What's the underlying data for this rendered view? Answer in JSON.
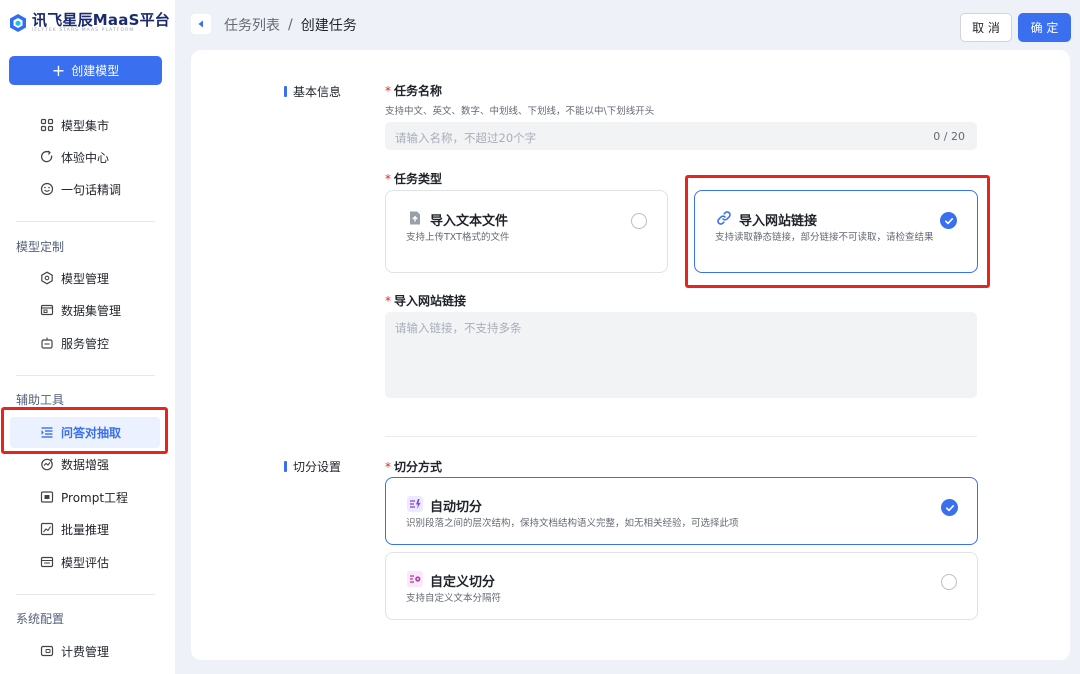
{
  "brand": {
    "name": "讯飞星辰MaaS平台",
    "subtitle": "IFLYTEK STARS MAAS PLATFORM"
  },
  "sidebar": {
    "create_button": "创建模型",
    "top_items": [
      {
        "label": "模型集市",
        "icon": "grid-icon"
      },
      {
        "label": "体验中心",
        "icon": "refresh-icon"
      },
      {
        "label": "一句话精调",
        "icon": "chat-icon"
      }
    ],
    "sections": [
      {
        "title": "模型定制",
        "items": [
          {
            "label": "模型管理",
            "icon": "shield-icon"
          },
          {
            "label": "数据集管理",
            "icon": "folder-icon"
          },
          {
            "label": "服务管控",
            "icon": "robot-icon"
          }
        ]
      },
      {
        "title": "辅助工具",
        "items": [
          {
            "label": "问答对抽取",
            "icon": "list-icon",
            "active": true
          },
          {
            "label": "数据增强",
            "icon": "sparkle-icon"
          },
          {
            "label": "Prompt工程",
            "icon": "terminal-icon"
          },
          {
            "label": "批量推理",
            "icon": "chart-icon"
          },
          {
            "label": "模型评估",
            "icon": "gauge-icon"
          }
        ]
      },
      {
        "title": "系统配置",
        "items": [
          {
            "label": "计费管理",
            "icon": "wallet-icon"
          }
        ]
      }
    ]
  },
  "header": {
    "breadcrumb_parent": "任务列表",
    "breadcrumb_separator": "/",
    "breadcrumb_current": "创建任务",
    "cancel_label": "取 消",
    "confirm_label": "确 定"
  },
  "form": {
    "basic_section": "基本信息",
    "task_name": {
      "label": "任务名称",
      "hint": "支持中文、英文、数字、中划线、下划线，不能以中\\下划线开头",
      "placeholder": "请输入名称，不超过20个字",
      "counter": "0 / 20"
    },
    "task_type": {
      "label": "任务类型",
      "options": [
        {
          "title": "导入文本文件",
          "desc": "支持上传TXT格式的文件",
          "icon": "file-upload-icon",
          "selected": false
        },
        {
          "title": "导入网站链接",
          "desc": "支持读取静态链接，部分链接不可读取，请检查结果",
          "icon": "link-icon",
          "selected": true
        }
      ]
    },
    "link": {
      "label": "导入网站链接",
      "placeholder": "请输入链接，不支持多条"
    },
    "split_section": "切分设置",
    "split_method": {
      "label": "切分方式",
      "options": [
        {
          "title": "自动切分",
          "desc": "识别段落之间的层次结构，保持文档结构语义完整，如无相关经验，可选择此项",
          "icon": "auto-split-icon",
          "selected": true
        },
        {
          "title": "自定义切分",
          "desc": "支持自定义文本分隔符",
          "icon": "custom-split-icon",
          "selected": false
        }
      ]
    }
  },
  "colors": {
    "accent": "#3a6ff0",
    "highlight_box": "#e5261f",
    "active_bg": "#ebf1fe"
  }
}
